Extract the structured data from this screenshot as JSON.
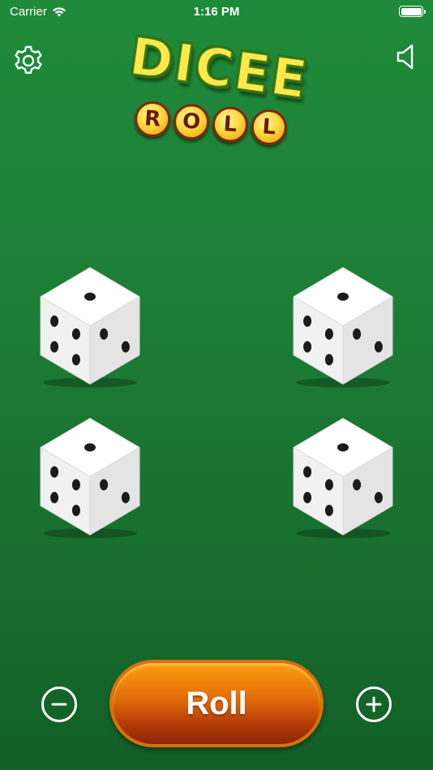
{
  "status_bar": {
    "carrier": "Carrier",
    "time": "1:16 PM"
  },
  "header": {
    "logo": {
      "line1": "DICEE",
      "line2_letters": [
        "R",
        "O",
        "L",
        "L"
      ]
    },
    "settings_icon": "gear-icon",
    "sound_icon": "speaker-icon"
  },
  "dice": [
    {
      "top_face": 1,
      "left_face": 4,
      "right_face": 2
    },
    {
      "top_face": 1,
      "left_face": 4,
      "right_face": 2
    },
    {
      "top_face": 1,
      "left_face": 4,
      "right_face": 2
    },
    {
      "top_face": 1,
      "left_face": 4,
      "right_face": 2
    }
  ],
  "controls": {
    "roll_label": "Roll",
    "decrease_icon": "minus-circle-icon",
    "increase_icon": "plus-circle-icon"
  },
  "colors": {
    "table_green": "#1d7d35",
    "roll_button_orange": "#e26b0a",
    "logo_yellow": "#ffe94a"
  }
}
